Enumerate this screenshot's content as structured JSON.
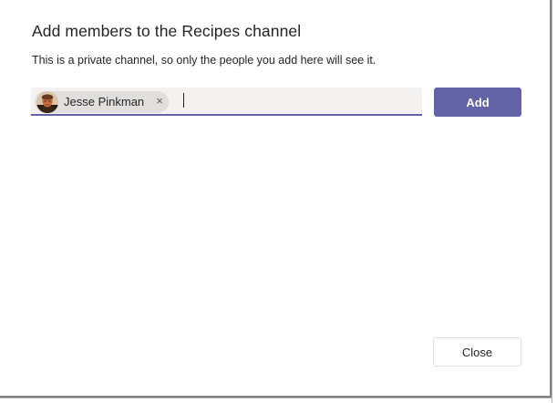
{
  "dialog": {
    "title": "Add members to the Recipes channel",
    "subtitle": "This is a private channel, so only the people you add here will see it."
  },
  "people_picker": {
    "selected": [
      {
        "name": "Jesse Pinkman",
        "remove_glyph": "×",
        "avatar_icon": "user-avatar-photo"
      }
    ],
    "input_value": "",
    "accent_color": "#6264a7"
  },
  "actions": {
    "add_label": "Add",
    "close_label": "Close",
    "add_color": "#6264a7"
  }
}
